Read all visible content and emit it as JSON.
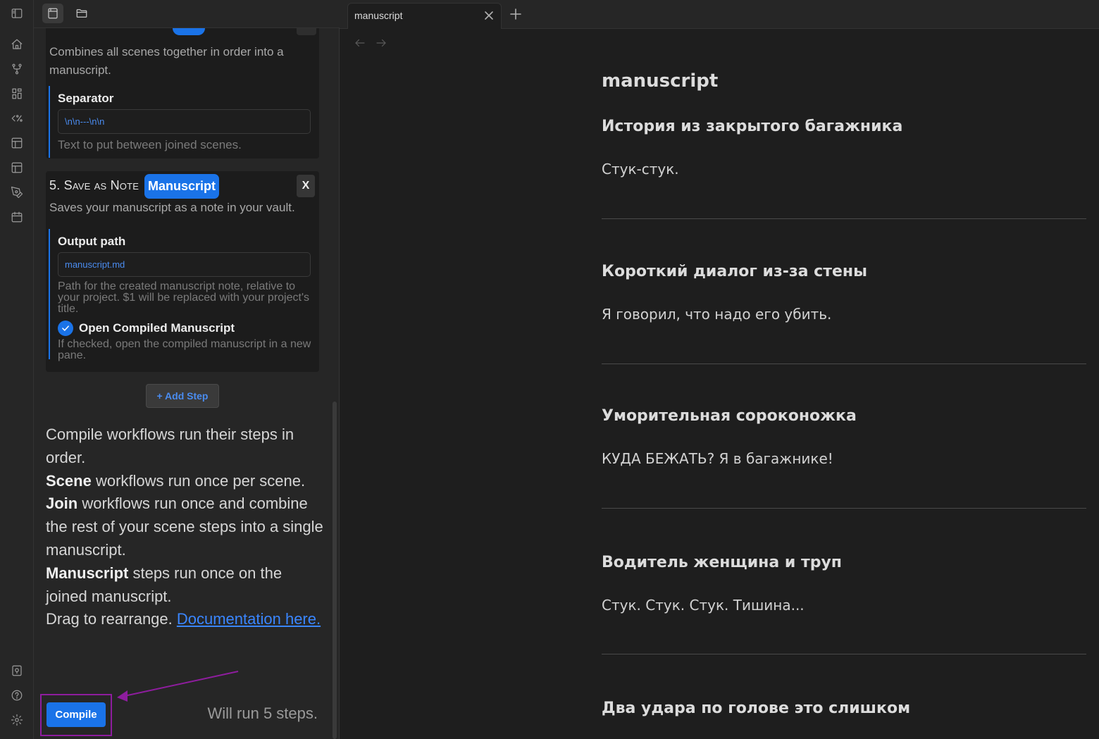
{
  "sidebar": {
    "card1": {
      "description": "Combines all scenes together in order into a manuscript.",
      "setting_label": "Separator",
      "setting_value": "\\n\\n---\\n\\n",
      "setting_help": "Text to put between joined scenes."
    },
    "card2": {
      "title": "5. Save as Note",
      "badge": "Manuscript",
      "remove": "X",
      "description": "Saves your manuscript as a note in your vault.",
      "output_label": "Output path",
      "output_value": "manuscript.md",
      "output_help": "Path for the created manuscript note, relative to your project. $1 will be replaced with your project's title.",
      "checkbox_label": "Open Compiled Manuscript",
      "checkbox_checked": true,
      "checkbox_help": "If checked, open the compiled manuscript in a new pane."
    },
    "add_step": "+ Add Step",
    "info": {
      "line1": "Compile workflows run their steps in order.",
      "scene_bold": "Scene",
      "scene_rest": " workflows run once per scene.",
      "join_bold": "Join",
      "join_rest": " workflows run once and combine the rest of your scene steps into a single manuscript.",
      "manuscript_bold": "Manuscript",
      "manuscript_rest": " steps run once on the joined manuscript.",
      "drag_text": "Drag to rearrange. ",
      "doc_link": "Documentation here."
    },
    "compile_button": "Compile",
    "run_count": "Will run 5 steps."
  },
  "tab": {
    "title": "manuscript"
  },
  "document": {
    "title": "manuscript",
    "sections": [
      {
        "heading": "История из закрытого багажника",
        "text": "Стук-стук."
      },
      {
        "heading": "Короткий диалог из-за стены",
        "text": "Я говорил, что надо его убить."
      },
      {
        "heading": "Уморительная сороконожка",
        "text": "КУДА БЕЖАТЬ? Я в багажнике!"
      },
      {
        "heading": "Водитель женщина и труп",
        "text": "Стук. Стук. Стук. Тишина..."
      },
      {
        "heading": "Два удара по голове это слишком",
        "text": ""
      }
    ]
  },
  "icons": {
    "ribbon": [
      "sidebar-toggle-icon",
      "home-icon",
      "git-fork-icon",
      "grid-icon",
      "template-icon",
      "layout-icon",
      "layout-alt-icon",
      "pen-tool-icon",
      "calendar-icon",
      "vault-icon",
      "help-icon",
      "settings-icon"
    ],
    "sidebar_tabs": [
      "files-panel-icon",
      "folder-icon"
    ]
  },
  "colors": {
    "accent": "#1a73e8",
    "link": "#3a86ff",
    "annotation": "#8e1d9e",
    "background": "#1e1e1e",
    "sidebar": "#262626"
  }
}
